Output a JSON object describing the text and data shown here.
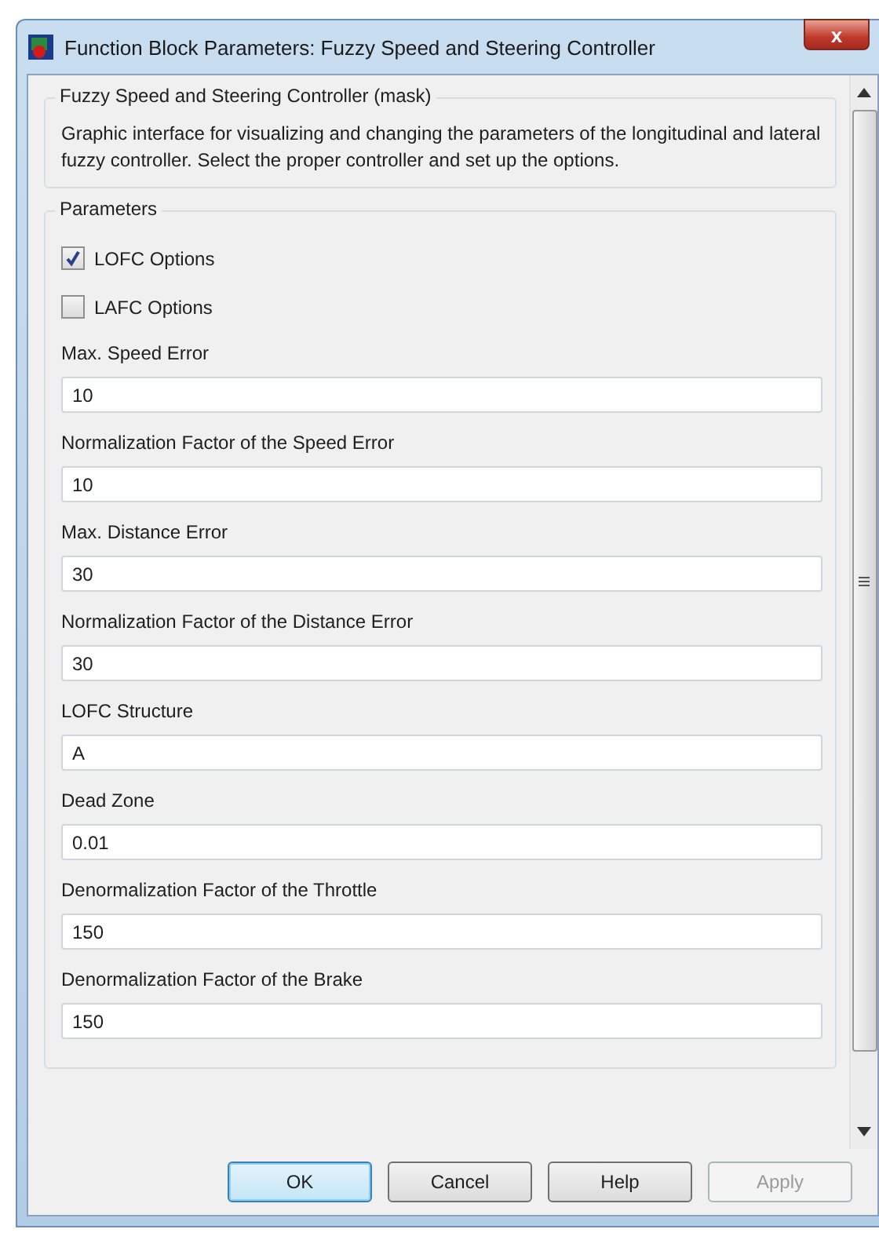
{
  "window": {
    "title": "Function Block Parameters: Fuzzy Speed and Steering Controller",
    "close": "x"
  },
  "description": {
    "title": "Fuzzy Speed and Steering Controller (mask)",
    "text": "Graphic interface for visualizing and changing the parameters of the longitudinal and lateral fuzzy controller. Select the proper controller and set up the options."
  },
  "parameters": {
    "title": "Parameters",
    "checkboxes": [
      {
        "label": "LOFC Options",
        "checked": true
      },
      {
        "label": "LAFC Options",
        "checked": false
      }
    ],
    "fields": [
      {
        "label": "Max. Speed Error",
        "value": "10"
      },
      {
        "label": "Normalization Factor of the Speed Error",
        "value": "10"
      },
      {
        "label": "Max. Distance Error",
        "value": "30"
      },
      {
        "label": "Normalization Factor of the Distance Error",
        "value": "30"
      },
      {
        "label": "LOFC Structure",
        "value": "A"
      },
      {
        "label": "Dead Zone",
        "value": "0.01"
      },
      {
        "label": "Denormalization Factor of the Throttle",
        "value": "150"
      },
      {
        "label": "Denormalization Factor of the Brake",
        "value": "150"
      }
    ]
  },
  "buttons": [
    {
      "label": "OK",
      "default": true,
      "disabled": false
    },
    {
      "label": "Cancel",
      "default": false,
      "disabled": false
    },
    {
      "label": "Help",
      "default": false,
      "disabled": false
    },
    {
      "label": "Apply",
      "default": false,
      "disabled": true
    }
  ]
}
